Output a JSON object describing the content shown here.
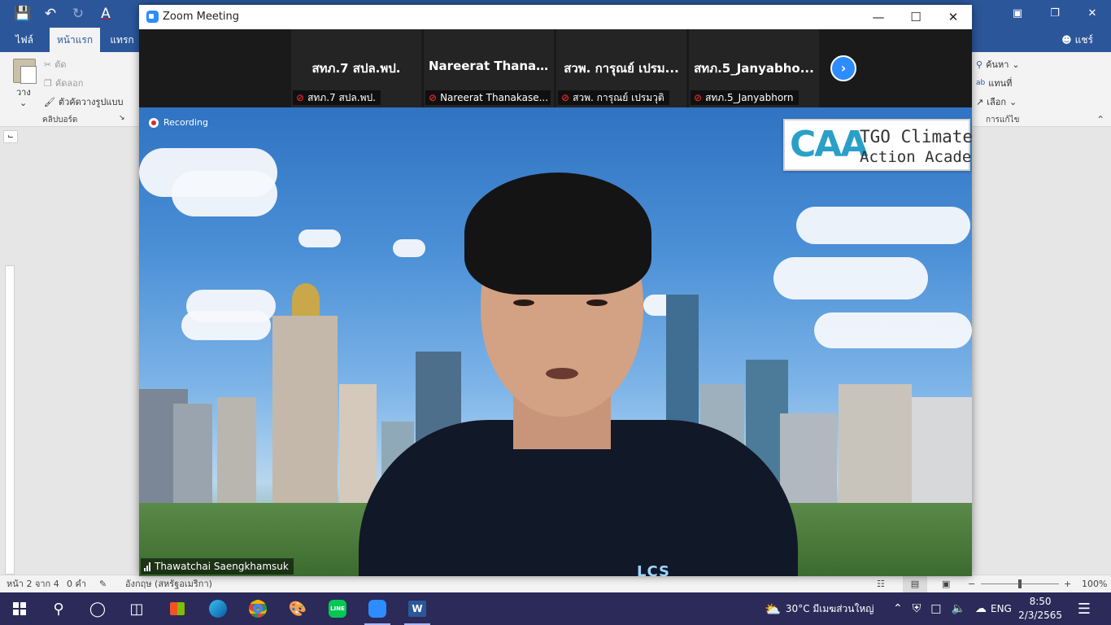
{
  "word": {
    "tabs": [
      {
        "label": "ไฟล์"
      },
      {
        "label": "หน้าแรก"
      },
      {
        "label": "แทรก"
      }
    ],
    "share_label": "แชร์",
    "clipboard": {
      "paste_label": "วาง",
      "cut_label": "ตัด",
      "copy_label": "คัดลอก",
      "format_painter_label": "ตัวคัดวางรูปแบบ",
      "group_label": "คลิปบอร์ด"
    },
    "editing": {
      "find_label": "ค้นหา",
      "replace_label": "แทนที่",
      "select_label": "เลือก",
      "group_label": "การแก้ไข"
    },
    "status": {
      "page": "หน้า 2 จาก 4",
      "words": "0 คำ",
      "language": "อังกฤษ (สหรัฐอเมริกา)",
      "zoom_minus": "−",
      "zoom_plus": "+",
      "zoom_level": "100%"
    }
  },
  "zoom": {
    "window_title": "Zoom Meeting",
    "participants": [
      {
        "display": "สทภ.7 สปล.พป.",
        "label": "สทภ.7 สปล.พป."
      },
      {
        "display": "Nareerat Thana...",
        "label": "Nareerat Thanakase..."
      },
      {
        "display": "สวพ. การุณย์ เปรม...",
        "label": "สวพ. การุณย์ เปรมวุติ"
      },
      {
        "display": "สทภ.5_Janyabho...",
        "label": "สทภ.5_Janyabhorn"
      }
    ],
    "recording_label": "Recording",
    "logo": {
      "big": "CAA",
      "line1": "TGO Climate",
      "line2": "Action Academy"
    },
    "speaker_name": "Thawatchai Saengkhamsuk",
    "shirt_text": "LCS"
  },
  "taskbar": {
    "weather": "30°C มีเมฆส่วนใหญ่",
    "language": "ENG",
    "time": "8:50",
    "date": "2/3/2565"
  },
  "colors": {
    "word_blue": "#2b579a",
    "zoom_blue": "#2d8cff",
    "taskbar": "#2b2a59",
    "mic_muted": "#e02828"
  }
}
